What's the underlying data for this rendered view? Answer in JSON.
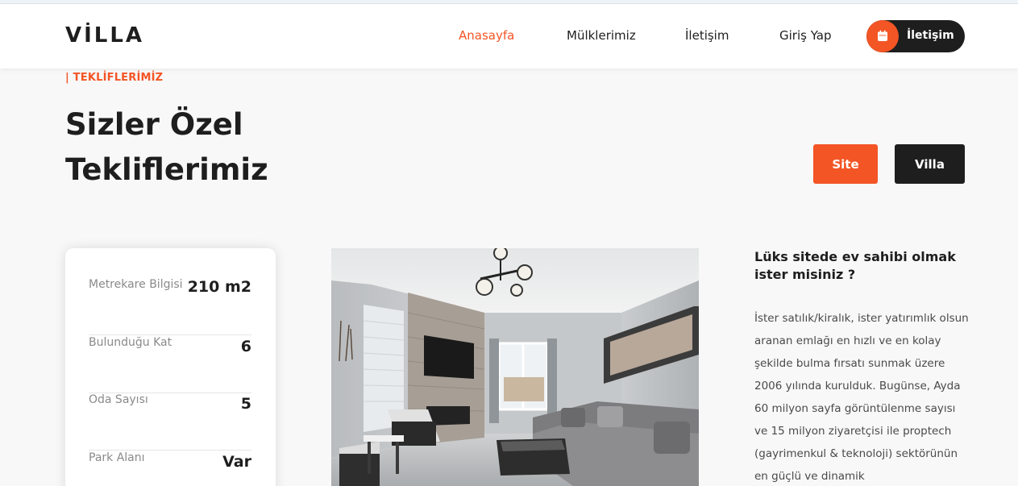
{
  "brand": {
    "logo": "VİLLA"
  },
  "nav": {
    "items": [
      {
        "label": "Anasayfa",
        "active": true
      },
      {
        "label": "Mülklerimiz",
        "active": false
      },
      {
        "label": "İletişim",
        "active": false
      },
      {
        "label": "Giriş Yap",
        "active": false
      }
    ],
    "cta_label": "İletişim",
    "cta_icon": "calendar-icon"
  },
  "hero": {
    "eyebrow": "| TEKLİFLERİMİZ",
    "title": "Sizler Özel Tekliflerimiz",
    "buttons": {
      "site": "Site",
      "villa": "Villa"
    }
  },
  "details": {
    "rows": [
      {
        "label": "Metrekare Bilgisi",
        "value": "210 m2"
      },
      {
        "label": "Bulunduğu Kat",
        "value": "6"
      },
      {
        "label": "Oda Sayısı",
        "value": "5"
      },
      {
        "label": "Park Alanı",
        "value": "Var"
      }
    ]
  },
  "side": {
    "title": "Lüks sitede ev sahibi olmak ister misiniz ?",
    "text": "İster satılık/kiralık, ister yatırımlık olsun aranan emlağı en hızlı ve en kolay şekilde bulma fırsatı sunmak üzere 2006 yılında kurulduk. Bugünse, Ayda 60 milyon sayfa görüntülenme sayısı ve 15 milyon ziyaretçisi ile proptech (gayrimenkul & teknoloji) sektörünün en güçlü ve dinamik"
  },
  "colors": {
    "accent": "#f35525",
    "dark": "#1e1e1e",
    "background": "#f8f8f8"
  }
}
